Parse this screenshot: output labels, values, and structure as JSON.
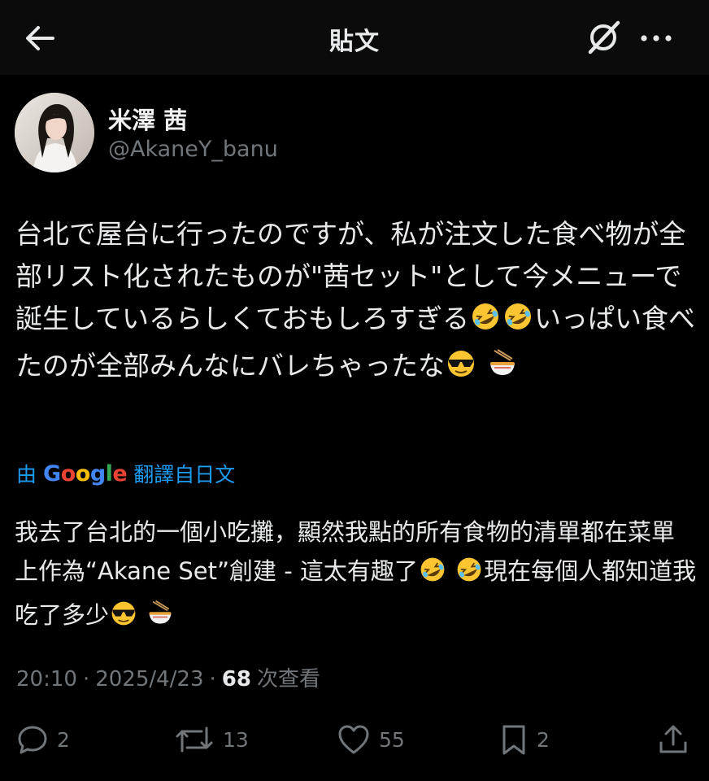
{
  "header": {
    "title": "貼文",
    "back_icon": "arrow-left-icon",
    "grok_icon": "grok-icon",
    "more_icon": "more-horizontal-icon"
  },
  "author": {
    "display_name": "米澤 茜",
    "handle": "@AkaneY_banu"
  },
  "tweet": {
    "text": "台北で屋台に行ったのですが、私が注文した食べ物が全部リスト化されたものが\"茜セット\"として今メニューで誕生しているらしくておもしろすぎる",
    "text_2": "いっぱい食べたのが全部みんなにバレちゃったな"
  },
  "translation": {
    "prefix": "由",
    "provider": "Google",
    "suffix": "翻譯自日文",
    "text": "我去了台北的一個小吃攤，顯然我點的所有食物的清單都在菜單上作為“Akane Set”創建 - 這太有趣了",
    "text_2": "現在每個人都知道我吃了多少"
  },
  "meta": {
    "time": "20:10",
    "sep1": "·",
    "date": "2025/4/23",
    "sep2": "·",
    "views": "68",
    "views_label": "次查看"
  },
  "actions": {
    "replies": "2",
    "reposts": "13",
    "likes": "55",
    "bookmarks": "2"
  },
  "colors": {
    "background": "#000000",
    "text": "#e7e9ea",
    "secondary": "#71767b",
    "link": "#1d9bf0"
  }
}
